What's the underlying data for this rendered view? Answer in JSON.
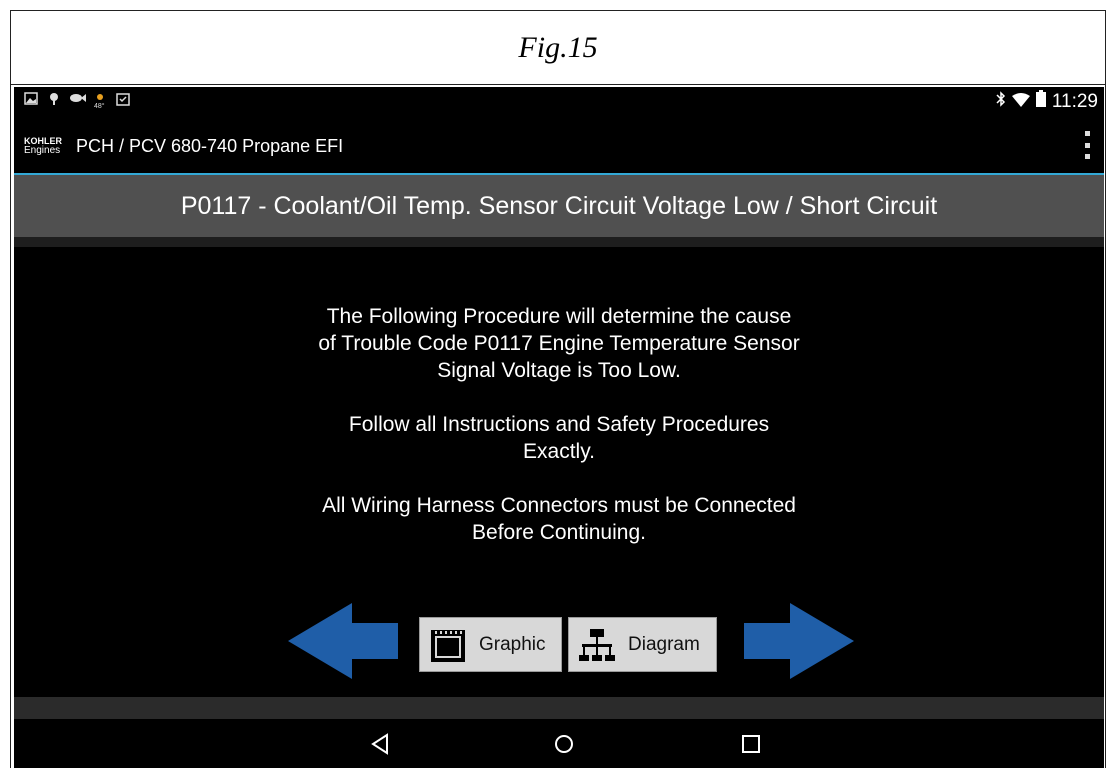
{
  "figure": {
    "caption": "Fig.15"
  },
  "status_bar": {
    "left_icons": [
      "image-icon",
      "android-debug-icon",
      "fish-icon",
      "weather-icon",
      "clipboard-check-icon"
    ],
    "weather_temp": "48°",
    "right_icons": [
      "bluetooth-icon",
      "wifi-icon",
      "battery-icon"
    ],
    "time": "11:29"
  },
  "action_bar": {
    "logo_line1": "KOHLER",
    "logo_line2": "Engines",
    "title": "PCH / PCV 680-740 Propane EFI",
    "menu_icon": "overflow-menu-icon"
  },
  "code_header": {
    "title": "P0117 - Coolant/Oil Temp. Sensor Circuit Voltage Low / Short Circuit"
  },
  "content": {
    "paragraph1": "The Following Procedure will determine the cause\nof Trouble Code P0117 Engine Temperature Sensor\nSignal Voltage is Too Low.",
    "paragraph2": "Follow all Instructions and Safety Procedures\nExactly.",
    "paragraph3": "All Wiring Harness Connectors must be Connected\nBefore Continuing."
  },
  "buttons": {
    "back_arrow_icon": "arrow-left-icon",
    "graphic_label": "Graphic",
    "diagram_label": "Diagram",
    "next_arrow_icon": "arrow-right-icon"
  },
  "colors": {
    "accent_line": "#33a9d6",
    "arrow_blue": "#1f5ea8",
    "header_bg": "#505050"
  },
  "nav_bar": {
    "icons": [
      "back-triangle-icon",
      "home-circle-icon",
      "recents-square-icon"
    ]
  }
}
